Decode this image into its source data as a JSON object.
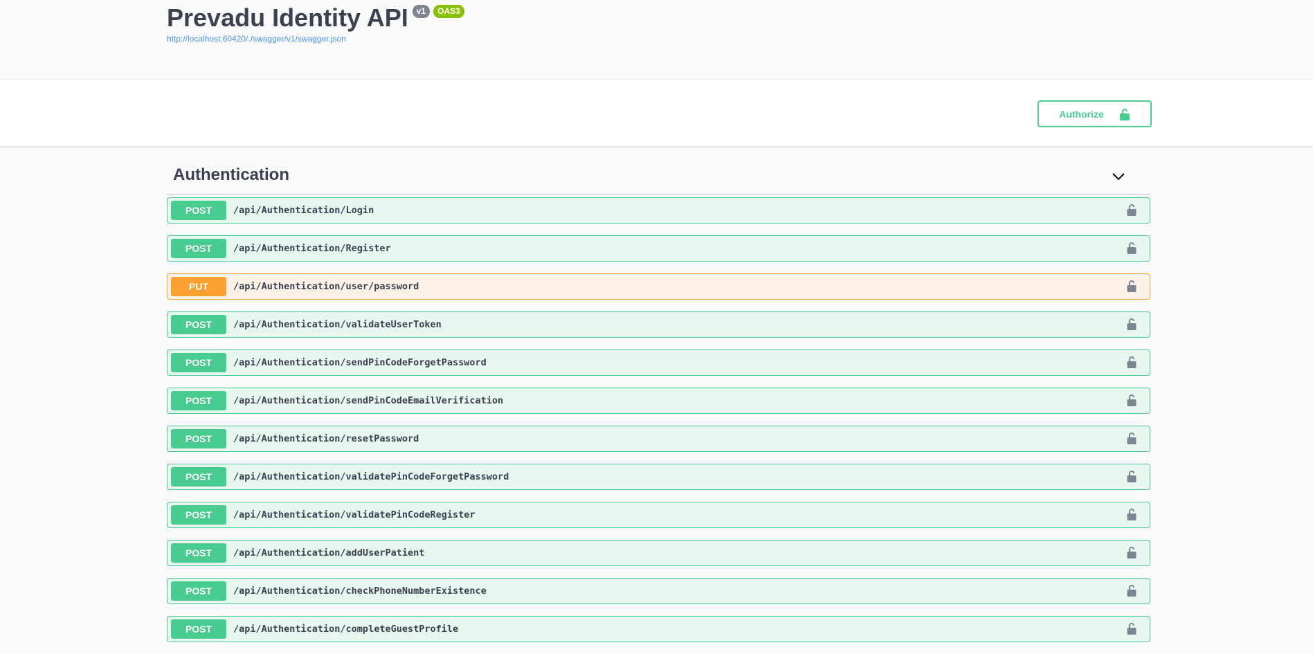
{
  "info": {
    "title": "Prevadu Identity API",
    "version_badge": "v1",
    "oas_badge": "OAS3",
    "spec_url": "http://localhost:60420/./swagger/v1/swagger.json"
  },
  "scheme": {
    "authorize_label": "Authorize"
  },
  "tag": {
    "name": "Authentication",
    "icon": "chevron-down-icon"
  },
  "colors": {
    "post": "#49cc90",
    "put": "#fca130",
    "text": "#3b4151",
    "link": "#4990e2"
  },
  "operations": [
    {
      "method": "POST",
      "path": "/api/Authentication/Login"
    },
    {
      "method": "POST",
      "path": "/api/Authentication/Register"
    },
    {
      "method": "PUT",
      "path": "/api/Authentication/user/password"
    },
    {
      "method": "POST",
      "path": "/api/Authentication/validateUserToken"
    },
    {
      "method": "POST",
      "path": "/api/Authentication/sendPinCodeForgetPassword"
    },
    {
      "method": "POST",
      "path": "/api/Authentication/sendPinCodeEmailVerification"
    },
    {
      "method": "POST",
      "path": "/api/Authentication/resetPassword"
    },
    {
      "method": "POST",
      "path": "/api/Authentication/validatePinCodeForgetPassword"
    },
    {
      "method": "POST",
      "path": "/api/Authentication/validatePinCodeRegister"
    },
    {
      "method": "POST",
      "path": "/api/Authentication/addUserPatient"
    },
    {
      "method": "POST",
      "path": "/api/Authentication/checkPhoneNumberExistence"
    },
    {
      "method": "POST",
      "path": "/api/Authentication/completeGuestProfile"
    }
  ]
}
